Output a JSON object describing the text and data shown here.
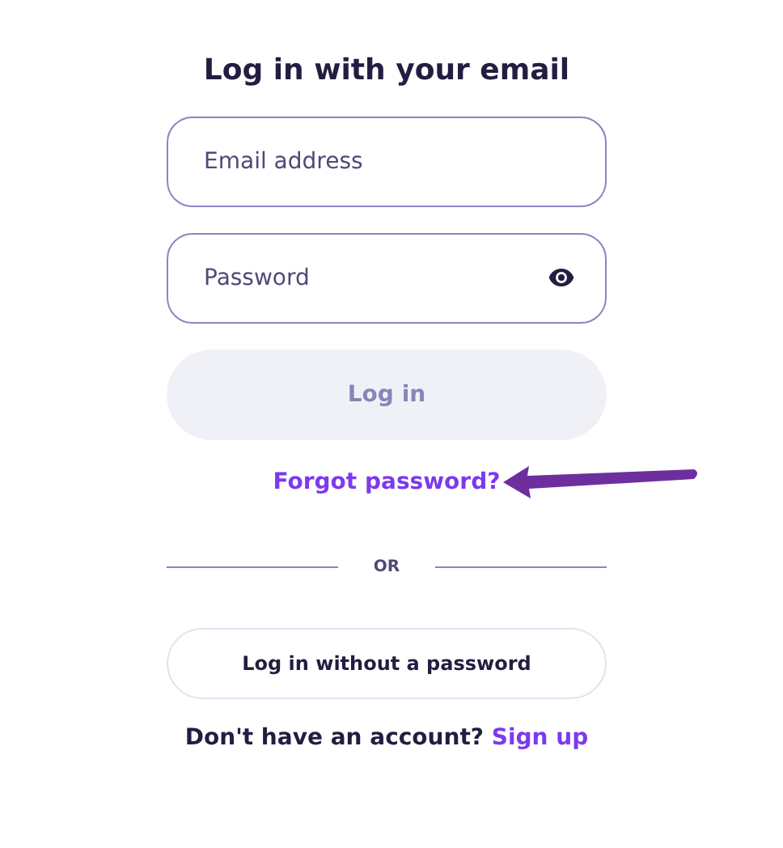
{
  "title": "Log in with your email",
  "email_field": {
    "placeholder": "Email address"
  },
  "password_field": {
    "placeholder": "Password"
  },
  "login_button": {
    "label": "Log in",
    "disabled": true
  },
  "forgot_link": "Forgot password?",
  "divider": "OR",
  "passwordless_button": {
    "label": "Log in without a password"
  },
  "signup": {
    "text": "Don't have an account?",
    "link": "Sign up"
  }
}
